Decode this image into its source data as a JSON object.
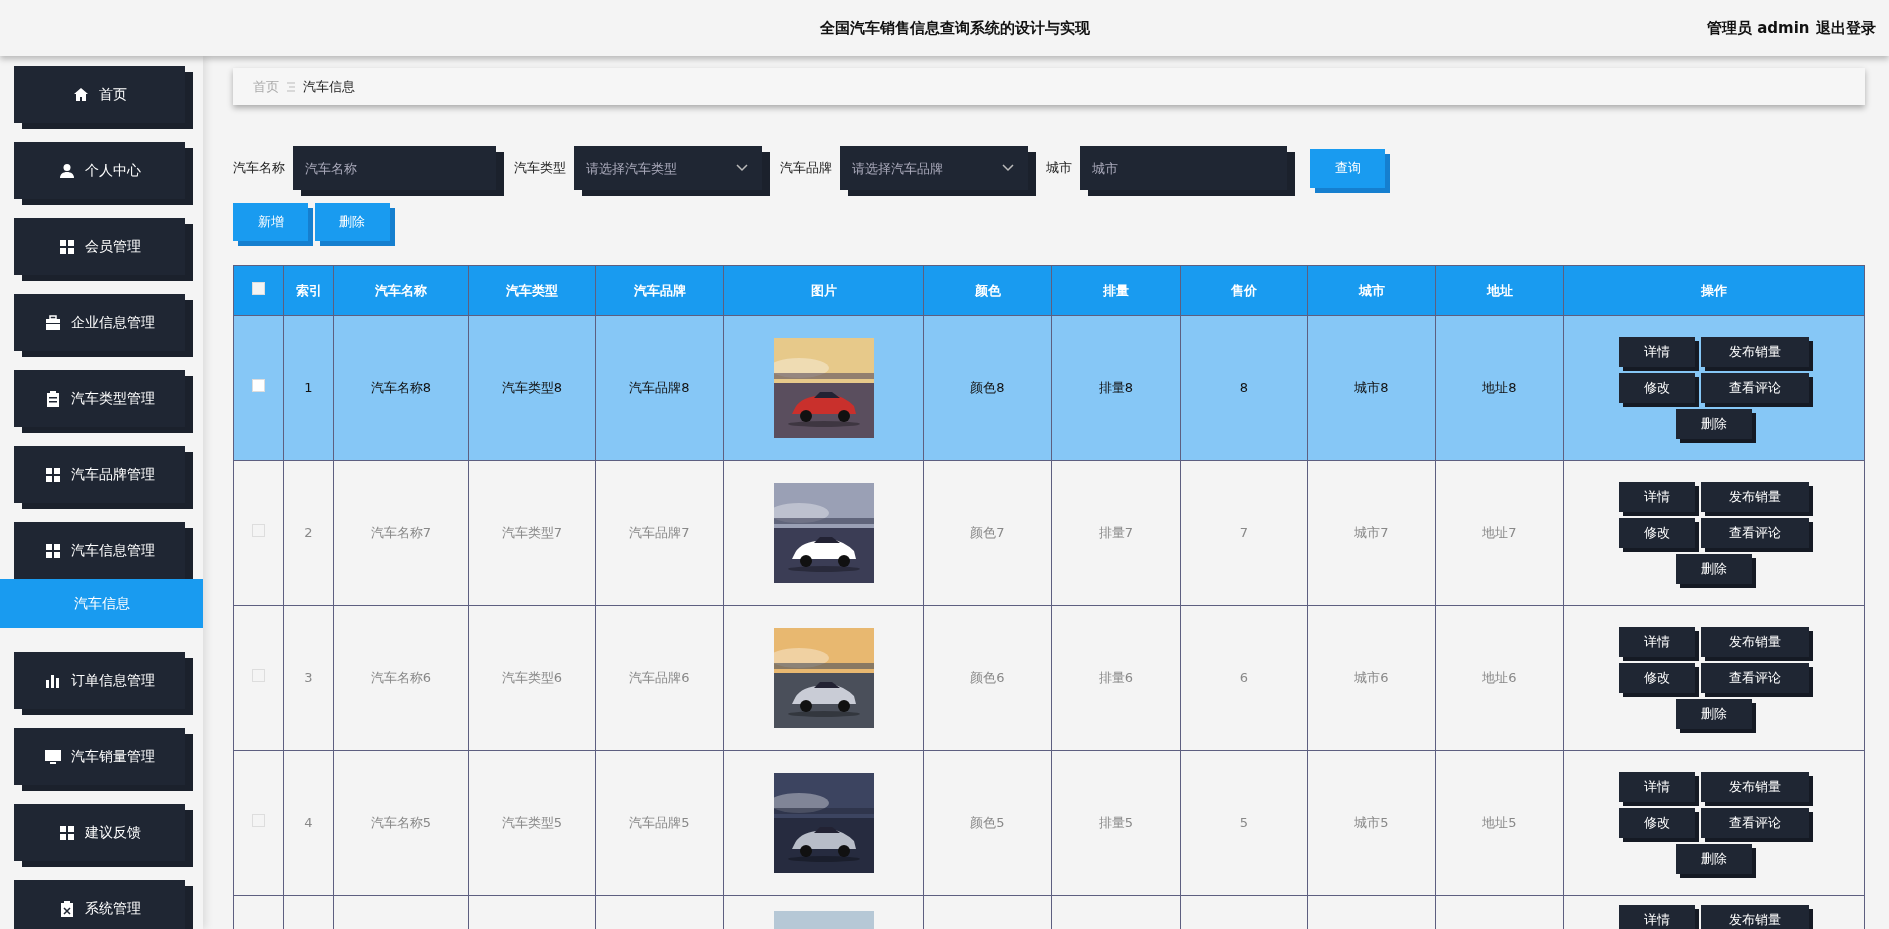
{
  "header": {
    "title": "全国汽车销售信息查询系统的设计与实现",
    "user": "管理员 admin",
    "logout": "退出登录"
  },
  "sidebar": {
    "items": [
      {
        "label": "首页"
      },
      {
        "label": "个人中心"
      },
      {
        "label": "会员管理"
      },
      {
        "label": "企业信息管理"
      },
      {
        "label": "汽车类型管理"
      },
      {
        "label": "汽车品牌管理"
      },
      {
        "label": "汽车信息管理",
        "children": [
          {
            "label": "汽车信息",
            "selected": true
          }
        ]
      },
      {
        "label": "订单信息管理"
      },
      {
        "label": "汽车销量管理"
      },
      {
        "label": "建议反馈"
      },
      {
        "label": "系统管理"
      }
    ]
  },
  "breadcrumb": [
    "首页",
    "汽车信息"
  ],
  "search": {
    "fields": [
      {
        "label": "汽车名称",
        "kind": "input",
        "placeholder": "汽车名称"
      },
      {
        "label": "汽车类型",
        "kind": "select",
        "placeholder": "请选择汽车类型"
      },
      {
        "label": "汽车品牌",
        "kind": "select",
        "placeholder": "请选择汽车品牌"
      },
      {
        "label": "城市",
        "kind": "input",
        "placeholder": "城市"
      }
    ],
    "button": "查询"
  },
  "toolbar": [
    "新增",
    "删除"
  ],
  "table": {
    "header_checkbox": {
      "checked": false
    },
    "columns": [
      {
        "label": "索引",
        "kind": "text"
      },
      {
        "label": "汽车名称",
        "kind": "text"
      },
      {
        "label": "汽车类型",
        "kind": "text"
      },
      {
        "label": "汽车品牌",
        "kind": "text"
      },
      {
        "label": "图片",
        "kind": "picture"
      },
      {
        "label": "颜色",
        "kind": "text"
      },
      {
        "label": "排量",
        "kind": "text"
      },
      {
        "label": "售价",
        "kind": "text"
      },
      {
        "label": "城市",
        "kind": "text"
      },
      {
        "label": "地址",
        "kind": "text"
      },
      {
        "label": "操作",
        "kind": "actions"
      }
    ],
    "rows": [
      {
        "selected": true,
        "checked": false,
        "cells": [
          "1",
          "汽车名称8",
          "汽车类型8",
          "汽车品牌8",
          "颜色8",
          "排量8",
          "8",
          "城市8",
          "地址8"
        ],
        "actions": [
          "详情",
          "发布销量",
          "修改",
          "查看评论",
          "删除"
        ]
      },
      {
        "selected": false,
        "checked": false,
        "cells": [
          "2",
          "汽车名称7",
          "汽车类型7",
          "汽车品牌7",
          "颜色7",
          "排量7",
          "7",
          "城市7",
          "地址7"
        ],
        "actions": [
          "详情",
          "发布销量",
          "修改",
          "查看评论",
          "删除"
        ]
      },
      {
        "selected": false,
        "checked": false,
        "cells": [
          "3",
          "汽车名称6",
          "汽车类型6",
          "汽车品牌6",
          "颜色6",
          "排量6",
          "6",
          "城市6",
          "地址6"
        ],
        "actions": [
          "详情",
          "发布销量",
          "修改",
          "查看评论",
          "删除"
        ]
      },
      {
        "selected": false,
        "checked": false,
        "cells": [
          "4",
          "汽车名称5",
          "汽车类型5",
          "汽车品牌5",
          "颜色5",
          "排量5",
          "5",
          "城市5",
          "地址5"
        ],
        "actions": [
          "详情",
          "发布销量",
          "修改",
          "查看评论",
          "删除"
        ]
      },
      {
        "selected": false,
        "actions": [
          "详情",
          "发布销量"
        ]
      }
    ]
  }
}
